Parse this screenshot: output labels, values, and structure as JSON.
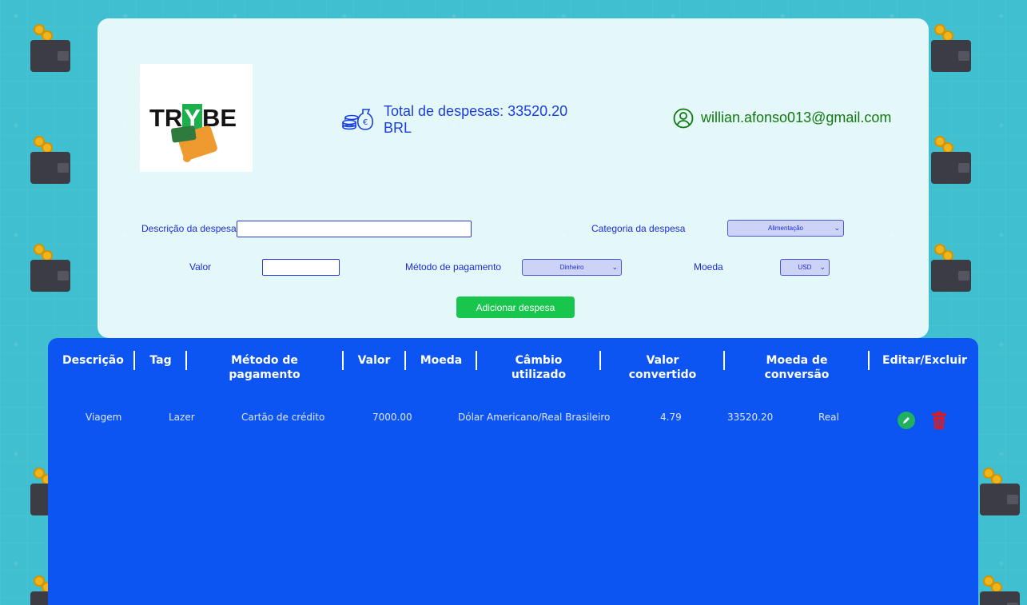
{
  "app": {
    "logo_text_1": "TR",
    "logo_text_y": "Y",
    "logo_text_2": "BE"
  },
  "header": {
    "total_label": "Total de despesas: 33520.20 BRL",
    "email": "willian.afonso013@gmail.com"
  },
  "form": {
    "description_label": "Descrição da despesa",
    "description_value": "",
    "category_label": "Categoria da despesa",
    "category_selected": "Alimentação",
    "value_label": "Valor",
    "value_value": "",
    "payment_label": "Método de pagamento",
    "payment_selected": "Dinheiro",
    "currency_label": "Moeda",
    "currency_selected": "USD",
    "add_button": "Adicionar despesa"
  },
  "table": {
    "headers": [
      "Descrição",
      "Tag",
      "Método de pagamento",
      "Valor",
      "Moeda",
      "Câmbio utilizado",
      "Valor convertido",
      "Moeda de conversão",
      "Editar/Excluir"
    ],
    "rows": [
      {
        "description": "Viagem",
        "tag": "Lazer",
        "method": "Cartão de crédito",
        "value": "7000.00",
        "currency": "Dólar Americano/Real Brasileiro",
        "rate": "4.79",
        "converted": "33520.20",
        "conversion_currency": "Real"
      }
    ]
  },
  "icons": {
    "money": "money-bag-icon",
    "user": "user-circle-icon",
    "edit": "pencil-icon",
    "delete": "trash-icon"
  },
  "colors": {
    "accent": "#0d55f3",
    "button": "#18c54d",
    "email": "#10790f",
    "delete": "#e01a1a"
  }
}
